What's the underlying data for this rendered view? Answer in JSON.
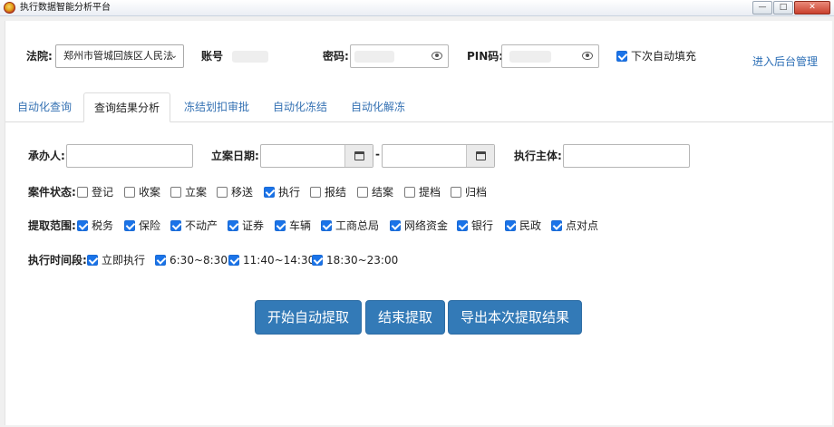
{
  "window": {
    "title": "执行数据智能分析平台",
    "min_label": "—",
    "max_label": "□",
    "close_label": "✕"
  },
  "top": {
    "court_label": "法院:",
    "court_value": "郑州市管城回族区人民法",
    "account_label": "账号",
    "password_label": "密码:",
    "pin_label": "PIN码:",
    "autofill_label": "下次自动填充",
    "autofill_checked": true,
    "admin_link": "进入后台管理"
  },
  "tabs": [
    {
      "label": "自动化查询",
      "active": false
    },
    {
      "label": "查询结果分析",
      "active": true
    },
    {
      "label": "冻结划扣审批",
      "active": false
    },
    {
      "label": "自动化冻结",
      "active": false
    },
    {
      "label": "自动化解冻",
      "active": false
    }
  ],
  "filters": {
    "handler_label": "承办人:",
    "filing_date_label": "立案日期:",
    "date_separator": "-",
    "subject_label": "执行主体:"
  },
  "case_status": {
    "label": "案件状态:",
    "options": [
      {
        "label": "登记",
        "checked": false
      },
      {
        "label": "收案",
        "checked": false
      },
      {
        "label": "立案",
        "checked": false
      },
      {
        "label": "移送",
        "checked": false
      },
      {
        "label": "执行",
        "checked": true
      },
      {
        "label": "报结",
        "checked": false
      },
      {
        "label": "结案",
        "checked": false
      },
      {
        "label": "提档",
        "checked": false
      },
      {
        "label": "归档",
        "checked": false
      }
    ]
  },
  "scope": {
    "label": "提取范围:",
    "options": [
      {
        "label": "税务",
        "checked": true
      },
      {
        "label": "保险",
        "checked": true
      },
      {
        "label": "不动产",
        "checked": true
      },
      {
        "label": "证券",
        "checked": true
      },
      {
        "label": "车辆",
        "checked": true
      },
      {
        "label": "工商总局",
        "checked": true
      },
      {
        "label": "网络资金",
        "checked": true
      },
      {
        "label": "银行",
        "checked": true
      },
      {
        "label": "民政",
        "checked": true
      },
      {
        "label": "点对点",
        "checked": true
      }
    ]
  },
  "time_period": {
    "label": "执行时间段:",
    "options": [
      {
        "label": "立即执行",
        "checked": true
      },
      {
        "label": "6:30~8:30",
        "checked": true
      },
      {
        "label": "11:40~14:30",
        "checked": true
      },
      {
        "label": "18:30~23:00",
        "checked": true
      }
    ]
  },
  "actions": {
    "start_label": "开始自动提取",
    "stop_label": "结束提取",
    "export_label": "导出本次提取结果"
  },
  "colors": {
    "accent": "#337ab7",
    "link": "#2d6fb6",
    "checkbox": "#1a73e8"
  }
}
